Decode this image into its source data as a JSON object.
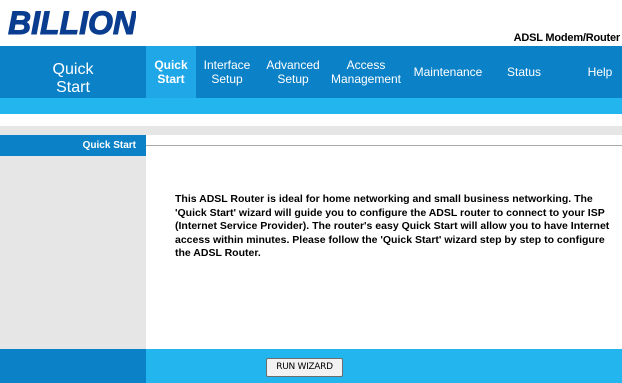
{
  "header": {
    "brand": "BILLION",
    "product": "ADSL Modem/Router"
  },
  "section": {
    "title": "Quick\nStart"
  },
  "nav": {
    "tabs": [
      {
        "label": "Quick\nStart"
      },
      {
        "label": "Interface\nSetup"
      },
      {
        "label": "Advanced\nSetup"
      },
      {
        "label": "Access\nManagement"
      },
      {
        "label": "Maintenance"
      },
      {
        "label": "Status"
      },
      {
        "label": "Help"
      }
    ]
  },
  "sidebar": {
    "label": "Quick Start"
  },
  "content": {
    "text": "This ADSL Router is ideal for home networking and small business networking. The 'Quick Start' wizard will guide you to configure the ADSL router to connect to your ISP (Internet Service Provider). The router's easy Quick Start will allow you to have Internet access within minutes. Please follow the 'Quick Start' wizard step by step to configure the ADSL Router."
  },
  "footer": {
    "button_label": "RUN WIZARD"
  },
  "colors": {
    "nav_dark": "#0b81c7",
    "nav_light": "#22b5ee",
    "active_tab": "#1fa7e8",
    "panel_gray": "#e6e6e6",
    "brand": "#0a3d8f"
  }
}
